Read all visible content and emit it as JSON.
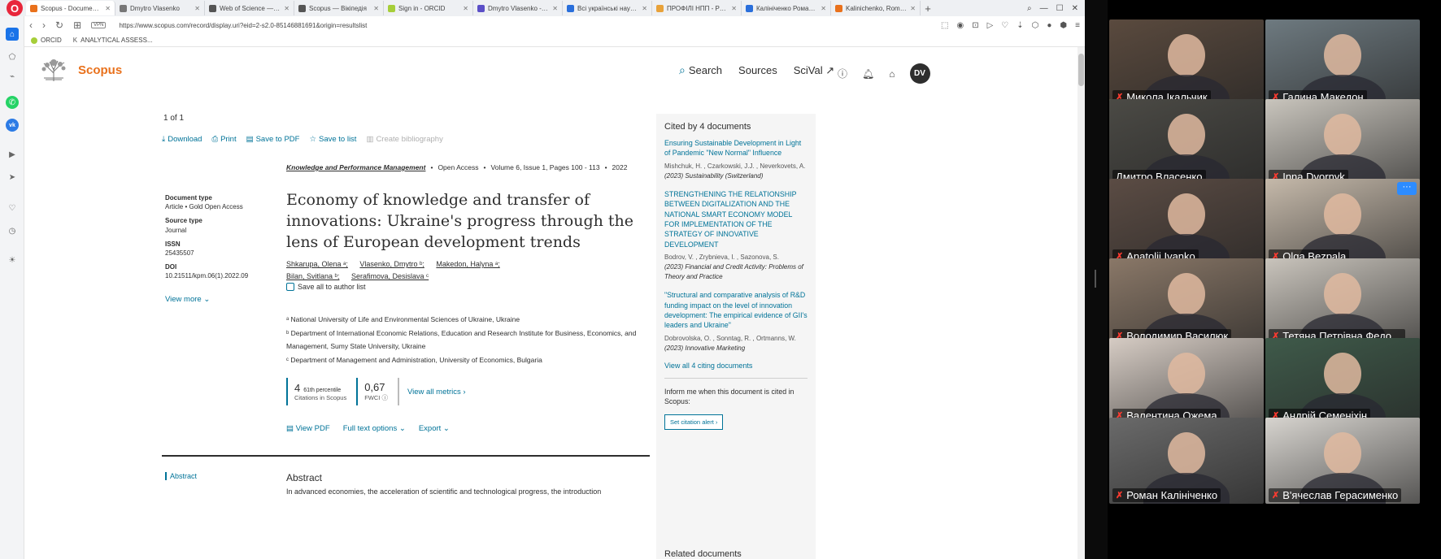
{
  "tabs": [
    {
      "title": "Scopus - Document details",
      "color": "#e9711c",
      "active": true
    },
    {
      "title": "Dmytro Vlasenko",
      "color": "#777777"
    },
    {
      "title": "Web of Science — Вікі",
      "color": "#555555"
    },
    {
      "title": "Scopus — Вікіпедія",
      "color": "#555555"
    },
    {
      "title": "Sign in - ORCID",
      "color": "#a6ce39"
    },
    {
      "title": "Dmytro Vlasenko - Wei",
      "color": "#5b4fc7"
    },
    {
      "title": "Всі українські науков",
      "color": "#2a6fdb"
    },
    {
      "title": "ПРОФІЛІ НПП - РОЗ",
      "color": "#e8a23a"
    },
    {
      "title": "Калініченко Роман Ан",
      "color": "#2a6fdb"
    },
    {
      "title": "Kalinichenko, Roman",
      "color": "#e9711c"
    }
  ],
  "toolbar": {
    "vpn": "VPN",
    "url": "https://www.scopus.com/record/display.uri?eid=2-s2.0-85146881691&origin=resultslist"
  },
  "bookmarks": [
    {
      "label": "ORCID"
    },
    {
      "label": "ANALYTICAL ASSESS..."
    }
  ],
  "scopus": {
    "logo": "Scopus",
    "nav": {
      "search": "Search",
      "sources": "Sources",
      "scival": "SciVal ↗"
    },
    "avatar": "DV",
    "result_count": "1 of 1",
    "actions": {
      "download": "Download",
      "print": "Print",
      "save_pdf": "Save to PDF",
      "save_list": "Save to list",
      "bibliography": "Create bibliography"
    },
    "source": {
      "journal": "Knowledge and Performance Management",
      "access": "Open Access",
      "volume": "Volume 6, Issue 1, Pages 100 - 113",
      "year": "2022"
    },
    "meta": {
      "doc_type_label": "Document type",
      "doc_type_value": "Article • Gold Open Access",
      "source_type_label": "Source type",
      "source_type_value": "Journal",
      "issn_label": "ISSN",
      "issn_value": "25435507",
      "doi_label": "DOI",
      "doi_value": "10.21511/kpm.06(1).2022.09",
      "view_more": "View more ⌄"
    },
    "title": "Economy of knowledge and transfer of innovations: Ukraine's progress through the lens of European development trends",
    "authors": [
      "Shkarupa, Olena ᵃ;",
      "Vlasenko, Dmytro ᵇ;",
      "Makedon, Halyna ᵃ;",
      "Bilan, Svitlana ᵇ;",
      "Serafimova, Desislava ᶜ"
    ],
    "save_authors": "Save all to author list",
    "affiliations": [
      "ᵃ National University of Life and Environmental Sciences of Ukraine, Ukraine",
      "ᵇ Department of International Economic Relations, Education and Research Institute for Business, Economics, and Management, Sumy State University, Ukraine",
      "ᶜ Department of Management and Administration, University of Economics, Bulgaria"
    ],
    "metrics": {
      "citations": "4",
      "percentile": "61th percentile",
      "citations_label": "Citations in Scopus",
      "fwci": "0,67",
      "fwci_label": "FWCI ⓘ",
      "view_all": "View all metrics ›"
    },
    "pdf_actions": {
      "view_pdf": "View PDF",
      "full_text": "Full text options ⌄",
      "export": "Export ⌄"
    },
    "abstract_nav": "Abstract",
    "abstract_title": "Abstract",
    "abstract_text": "In advanced economies, the acceleration of scientific and technological progress, the introduction",
    "cited": {
      "heading": "Cited by 4 documents",
      "items": [
        {
          "title": "Ensuring Sustainable Development in Light of Pandemic \"New Normal\" Influence",
          "authors": "Mishchuk, H. , Czarkowski, J.J. , Neverkovets, A.",
          "source": "(2023) Sustainability (Switzerland)"
        },
        {
          "title": "STRENGTHENING THE RELATIONSHIP BETWEEN DIGITALIZATION AND THE NATIONAL SMART ECONOMY MODEL FOR IMPLEMENTATION OF THE STRATEGY OF INNOVATIVE DEVELOPMENT",
          "authors": "Bodrov, V. , Zrybnieva, I. , Sazonova, S.",
          "source": "(2023) Financial and Credit Activity: Problems of Theory and Practice"
        },
        {
          "title": "\"Structural and comparative analysis of R&D funding impact on the level of innovation development: The empirical evidence of GII's leaders and Ukraine\"",
          "authors": "Dobrovolska, O. , Sonntag, R. , Ortmanns, W.",
          "source": "(2023) Innovative Marketing"
        }
      ],
      "view_all": "View all 4 citing documents",
      "inform": "Inform me when this document is cited in Scopus:",
      "alert_btn": "Set citation alert ›",
      "related": "Related documents"
    }
  },
  "participants": [
    {
      "name": "Микола Ікальчик",
      "muted": true,
      "bg": "#5a4a3e"
    },
    {
      "name": "Галина Македон",
      "muted": true,
      "bg": "#6e7a80"
    },
    {
      "name": "Дмитро Власенко",
      "muted": false,
      "bg": "#4b4a45",
      "speaker": true
    },
    {
      "name": "Inna Dvornyk",
      "muted": true,
      "bg": "#c9c5bd"
    },
    {
      "name": "Anatolii Ivanko",
      "muted": true,
      "bg": "#5b4c44"
    },
    {
      "name": "Olga Bezpala",
      "muted": true,
      "bg": "#c5b9aa"
    },
    {
      "name": "Володимир Василюк",
      "muted": true,
      "bg": "#8a7868"
    },
    {
      "name": "Тетяна Петрівна Федо…",
      "muted": true,
      "bg": "#c9c4bc"
    },
    {
      "name": "Валентина Ожема",
      "muted": true,
      "bg": "#d6ccc4"
    },
    {
      "name": "Андрій Семеніхін",
      "muted": true,
      "bg": "#3f5a4a"
    },
    {
      "name": "Роман Калініченко",
      "muted": true,
      "bg": "#6a6a6a"
    },
    {
      "name": "В'ячеслав Герасименко",
      "muted": true,
      "bg": "#d7d4cf"
    }
  ],
  "more_button": "···"
}
